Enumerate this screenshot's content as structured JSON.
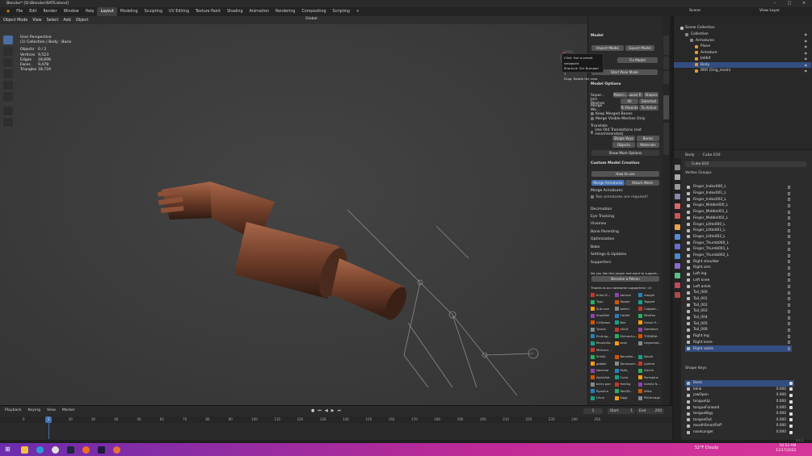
{
  "window": {
    "title": "Blender* [D:\\Blender\\RATS.blend]",
    "controls": [
      "–",
      "□",
      "✕"
    ]
  },
  "menu": [
    "File",
    "Edit",
    "Render",
    "Window",
    "Help"
  ],
  "workspaces": [
    "Layout",
    "Modeling",
    "Sculpting",
    "UV Editing",
    "Texture Paint",
    "Shading",
    "Animation",
    "Rendering",
    "Compositing",
    "Scripting",
    "+"
  ],
  "scene": {
    "icon": "scene-icon",
    "label": "Scene",
    "view_layer": "View Layer"
  },
  "viewport": {
    "mode": "Object Mode",
    "menus": [
      "View",
      "Select",
      "Add",
      "Object"
    ],
    "orientation": "Global",
    "options": "Options",
    "overlay": {
      "line1": "User Perspective",
      "line2": "(1) Collection | Body : Basis",
      "stats": [
        {
          "k": "Objects",
          "v": "0 / 2"
        },
        {
          "k": "Vertices",
          "v": "9,523"
        },
        {
          "k": "Edges",
          "v": "18,606"
        },
        {
          "k": "Faces",
          "v": "9,478"
        },
        {
          "k": "Triangles",
          "v": "18,724"
        }
      ]
    },
    "tooltip": [
      "Click: Use a preset viewpoint",
      "Shortcut: Ctrl Numpad 7",
      "Drag: Rotate the view"
    ]
  },
  "npanel": {
    "model": "Model",
    "import": "Import Model",
    "export": "Export Model",
    "fix_model": "Fix Model",
    "start_pose": "Start Pose Mode",
    "model_options": "Model Options",
    "separate": "Separ...",
    "separate_btns": [
      "Materi...",
      "Loose P...",
      "Shapes"
    ],
    "join": "Join Meshes",
    "join_btns": [
      "All",
      "Selected"
    ],
    "merge_weights": "Merge We...",
    "merge_btns": [
      "To Parents",
      "To Active"
    ],
    "keep_merged": "Keep Merged Bones",
    "merge_visible": "Merge Visible Meshes Only",
    "translate": "Translate",
    "use_old": "Use Old Translations (not recommended)",
    "translate_btns": [
      "Shape Keys",
      "Bones",
      "Objects",
      "Materials"
    ],
    "show_more": "Show More Options",
    "custom": "Custom Model Creation",
    "how_to": "How to use",
    "merge_armatures": "Merge Armatures",
    "attach_mesh": "Attach Mesh",
    "merge_armatures_label": "Merge Armatures",
    "two_required": "Two armatures are required!",
    "sections": [
      "Decimation",
      "Eye Tracking",
      "Visemes",
      "Bone Parenting",
      "Optimization",
      "Bake",
      "Settings & Updates"
    ],
    "supporters": "Supporters",
    "support_text": "Do you like this plugin and want to support...",
    "patron": "Become a Patron",
    "thanks": "Thanks to our awesome supporters! <3",
    "names": [
      "Erika M...",
      "Abrrom",
      "Google",
      "Typo",
      "Topper",
      "Topped",
      "Sub.com",
      "weez1",
      "Catgate...",
      "SmolDeli",
      "Catlief",
      "MissFox",
      "Ch3kewa",
      "Bee",
      "Fressh P...",
      "Tyrack",
      "xSLIX",
      "Daredevs",
      "Fruit-ap...",
      "Shimechu...",
      "TOBIKNA",
      "Revolutio...",
      "sese",
      "Legomast...",
      "MGlcorn...",
      "",
      "",
      "Shrikk",
      "Benzehe...",
      "Akuzh",
      "gabbie",
      "Taimosaki...",
      "Lyderia",
      "Narsinar",
      "Mule_",
      "Alerrhi",
      "AlphaSat",
      "Curio",
      "Porraptus",
      "berry pan",
      "Hailing",
      "namila N...",
      "Ryanlira",
      "Tobi3D...",
      "Wikiz",
      "Lihun",
      "Siggi",
      "PKCarnage"
    ]
  },
  "outliner": {
    "title": "Scene Collection",
    "rows": [
      {
        "d": 1,
        "t": "Collection",
        "c": "#8a8a8a"
      },
      {
        "d": 2,
        "t": "Armatures",
        "c": "#8a8a8a"
      },
      {
        "d": 3,
        "t": "Plane",
        "c": "#e09a3a"
      },
      {
        "d": 3,
        "t": "Armature",
        "c": "#e09a3a"
      },
      {
        "d": 3,
        "t": "Jabbit",
        "c": "#e09a3a"
      },
      {
        "d": 3,
        "t": "Body",
        "c": "#e09a3a"
      },
      {
        "d": 3,
        "t": "RRR (Orig_mesh)",
        "c": "#e09a3a"
      }
    ]
  },
  "properties": {
    "object": "Body",
    "mesh": "Cube.010",
    "mesh_field": "Cube.010",
    "vertex_groups": "Vertex Groups",
    "groups": [
      "Finger_Index000_L",
      "Finger_Index001_L",
      "Finger_Index002_L",
      "Finger_Middle000_L",
      "Finger_Middle001_L",
      "Finger_Middle002_L",
      "Finger_Little000_L",
      "Finger_Little001_L",
      "Finger_Little002_L",
      "Finger_Thumb000_L",
      "Finger_Thumb001_L",
      "Finger_Thumb002_L",
      "Right shoulder",
      "Right arm",
      "Left leg",
      "Left knee",
      "Left ankle",
      "Tail_000",
      "Tail_001",
      "Tail_002",
      "Tail_003",
      "Tail_004",
      "Tail_005",
      "Tail_006",
      "Right leg",
      "Right knee",
      "Right ankle"
    ],
    "shape_keys": "Shape Keys",
    "keys": [
      {
        "n": "Basis",
        "v": ""
      },
      {
        "n": "blink",
        "v": "0.000"
      },
      {
        "n": "jawOpen",
        "v": "0.000"
      },
      {
        "n": "tongueUp",
        "v": "0.000"
      },
      {
        "n": "tongueForward",
        "v": "0.000"
      },
      {
        "n": "tongueBigy",
        "v": "0.000"
      },
      {
        "n": "tongueOut",
        "v": "0.000"
      },
      {
        "n": "mouthSmartPuff",
        "v": "0.000"
      },
      {
        "n": "noseLonger",
        "v": "0.000"
      }
    ]
  },
  "timeline": {
    "menus": [
      "Playback",
      "Keying",
      "View",
      "Marker"
    ],
    "frame": "1",
    "start_label": "Start",
    "start": "1",
    "end_label": "End",
    "end": "250",
    "ticks": [
      "0",
      "10",
      "20",
      "30",
      "40",
      "50",
      "60",
      "70",
      "80",
      "90",
      "100",
      "110",
      "120",
      "130",
      "140",
      "150",
      "160",
      "170",
      "180",
      "190",
      "200",
      "210",
      "220",
      "230",
      "240",
      "250"
    ],
    "version": "3.1.2"
  },
  "taskbar": {
    "weather": "52°F Cloudy",
    "time": "10:53 AM",
    "date": "11/17/2022"
  }
}
